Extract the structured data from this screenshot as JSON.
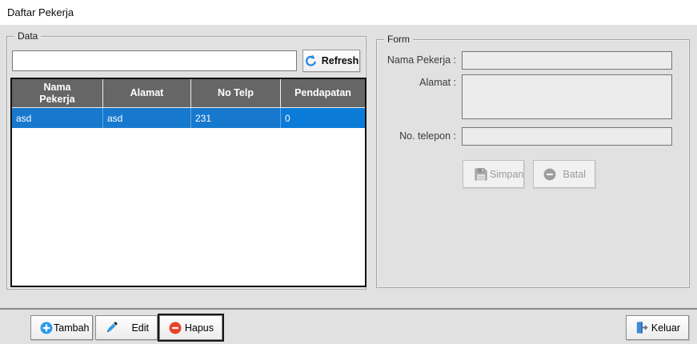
{
  "window": {
    "title": "Daftar Pekerja"
  },
  "data_section": {
    "label": "Data",
    "search": {
      "value": "",
      "placeholder": ""
    },
    "refresh_button": "Refresh",
    "table": {
      "columns": [
        "Nama Pekerja",
        "Alamat",
        "No Telp",
        "Pendapatan"
      ],
      "rows": [
        [
          "asd",
          "asd",
          "231",
          "0"
        ]
      ],
      "selected_row_index": 0
    }
  },
  "form_section": {
    "label": "Form",
    "fields": {
      "nama_label": "Nama Pekerja :",
      "nama_value": "",
      "alamat_label": "Alamat :",
      "alamat_value": "",
      "telepon_label": "No. telepon :",
      "telepon_value": ""
    },
    "buttons": {
      "simpan": "Simpan",
      "batal": "Batal"
    }
  },
  "toolbar": {
    "tambah": "Tambah",
    "edit": "Edit",
    "hapus": "Hapus",
    "keluar": "Keluar"
  },
  "icons": {
    "refresh": "refresh-circular-arrow",
    "simpan": "floppy-disk",
    "batal": "minus-circle-gray",
    "tambah": "plus-circle-blue",
    "edit": "pencil",
    "hapus": "minus-circle-red",
    "keluar": "door-exit-arrow"
  },
  "colors": {
    "panel_gray": "#e1e1e1",
    "table_header_gray": "#666666",
    "selected_row_blue": "#1779ce",
    "accent_blue": "#2196f3",
    "danger_red": "#e8442c",
    "disabled_gray": "#9e9e9e"
  }
}
